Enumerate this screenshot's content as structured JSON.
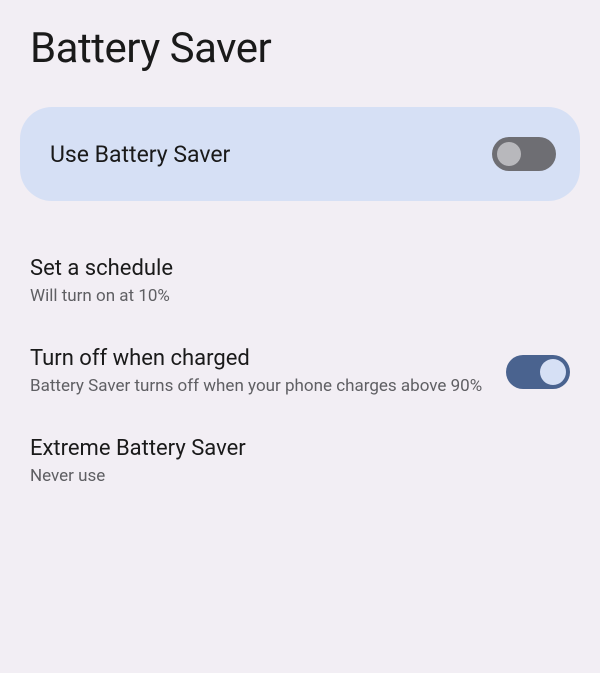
{
  "header": {
    "title": "Battery Saver"
  },
  "mainToggle": {
    "label": "Use Battery Saver",
    "state": "off"
  },
  "settings": {
    "schedule": {
      "title": "Set a schedule",
      "subtitle": "Will turn on at 10%"
    },
    "turnOffCharged": {
      "title": "Turn off when charged",
      "subtitle": "Battery Saver turns off when your phone charges above 90%",
      "state": "on"
    },
    "extreme": {
      "title": "Extreme Battery Saver",
      "subtitle": "Never use"
    }
  }
}
